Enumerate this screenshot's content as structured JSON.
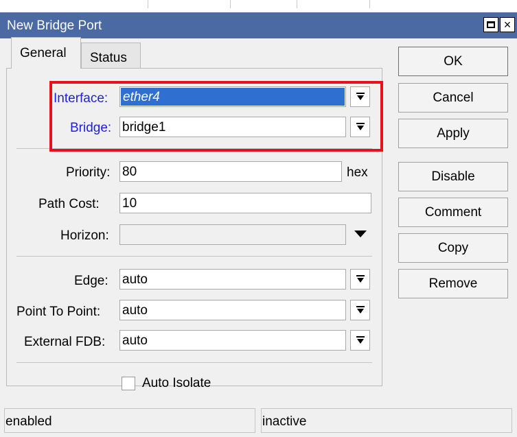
{
  "window": {
    "title": "New Bridge Port",
    "maximize_glyph": "maximize-icon",
    "close_glyph": "×"
  },
  "tabs": [
    {
      "label": "General",
      "active": true
    },
    {
      "label": "Status",
      "active": false
    }
  ],
  "form": {
    "interface_label": "Interface:",
    "interface_value": "ether4",
    "bridge_label": "Bridge:",
    "bridge_value": "bridge1",
    "priority_label": "Priority:",
    "priority_value": "80",
    "priority_suffix": "hex",
    "path_cost_label": "Path Cost:",
    "path_cost_value": "10",
    "horizon_label": "Horizon:",
    "horizon_value": "",
    "edge_label": "Edge:",
    "edge_value": "auto",
    "point_to_point_label": "Point To Point:",
    "point_to_point_value": "auto",
    "external_fdb_label": "External FDB:",
    "external_fdb_value": "auto",
    "auto_isolate_label": "Auto Isolate",
    "auto_isolate_checked": false
  },
  "buttons": {
    "ok": "OK",
    "cancel": "Cancel",
    "apply": "Apply",
    "disable": "Disable",
    "comment": "Comment",
    "copy": "Copy",
    "remove": "Remove"
  },
  "status_bar": {
    "left": "enabled",
    "right": "inactive"
  },
  "colors": {
    "titlebar": "#4b6aa4",
    "highlight_label": "#1e1ee6",
    "selection": "#2f6fd0",
    "annotation_box": "#e8101a"
  }
}
